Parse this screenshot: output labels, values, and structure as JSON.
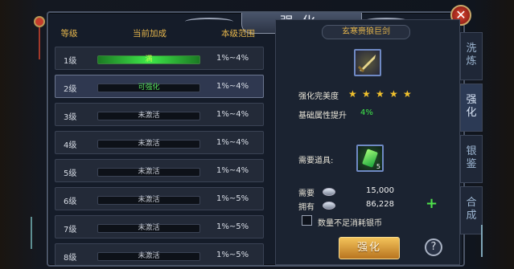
{
  "title": "强化",
  "close_icon": "close-icon",
  "left": {
    "headers": [
      "等级",
      "当前加成",
      "本级范围"
    ],
    "rows": [
      {
        "level": "1级",
        "status": "满",
        "range": "1%~4%"
      },
      {
        "level": "2级",
        "status": "可强化",
        "range": "1%~4%"
      },
      {
        "level": "3级",
        "status": "未激活",
        "range": "1%~4%"
      },
      {
        "level": "4级",
        "status": "未激活",
        "range": "1%~4%"
      },
      {
        "level": "5级",
        "status": "未激活",
        "range": "1%~4%"
      },
      {
        "level": "6级",
        "status": "未激活",
        "range": "1%~5%"
      },
      {
        "level": "7级",
        "status": "未激活",
        "range": "1%~5%"
      },
      {
        "level": "8级",
        "status": "未激活",
        "range": "1%~5%"
      }
    ],
    "selected_index": 1,
    "level1_fill": 1.0
  },
  "right": {
    "item_name": "玄寒赍狼巨剑",
    "perfection_label": "强化完美度",
    "stars": 5,
    "base_label": "基础属性提升",
    "base_value": "4%",
    "need_item_label": "需要道具:",
    "item_count": "5",
    "need_label": "需要",
    "need_value": "15,000",
    "have_label": "拥有",
    "have_value": "86,228",
    "checkbox_label": "数量不足消耗银币",
    "button_label": "强化",
    "help_label": "?"
  },
  "sidetabs": [
    "洗\n炼",
    "强\n化",
    "银\n鉴",
    "合\n成"
  ],
  "colors": {
    "gold": "#e6b64c",
    "green": "#3fe84a",
    "button": "#e2a23f"
  }
}
